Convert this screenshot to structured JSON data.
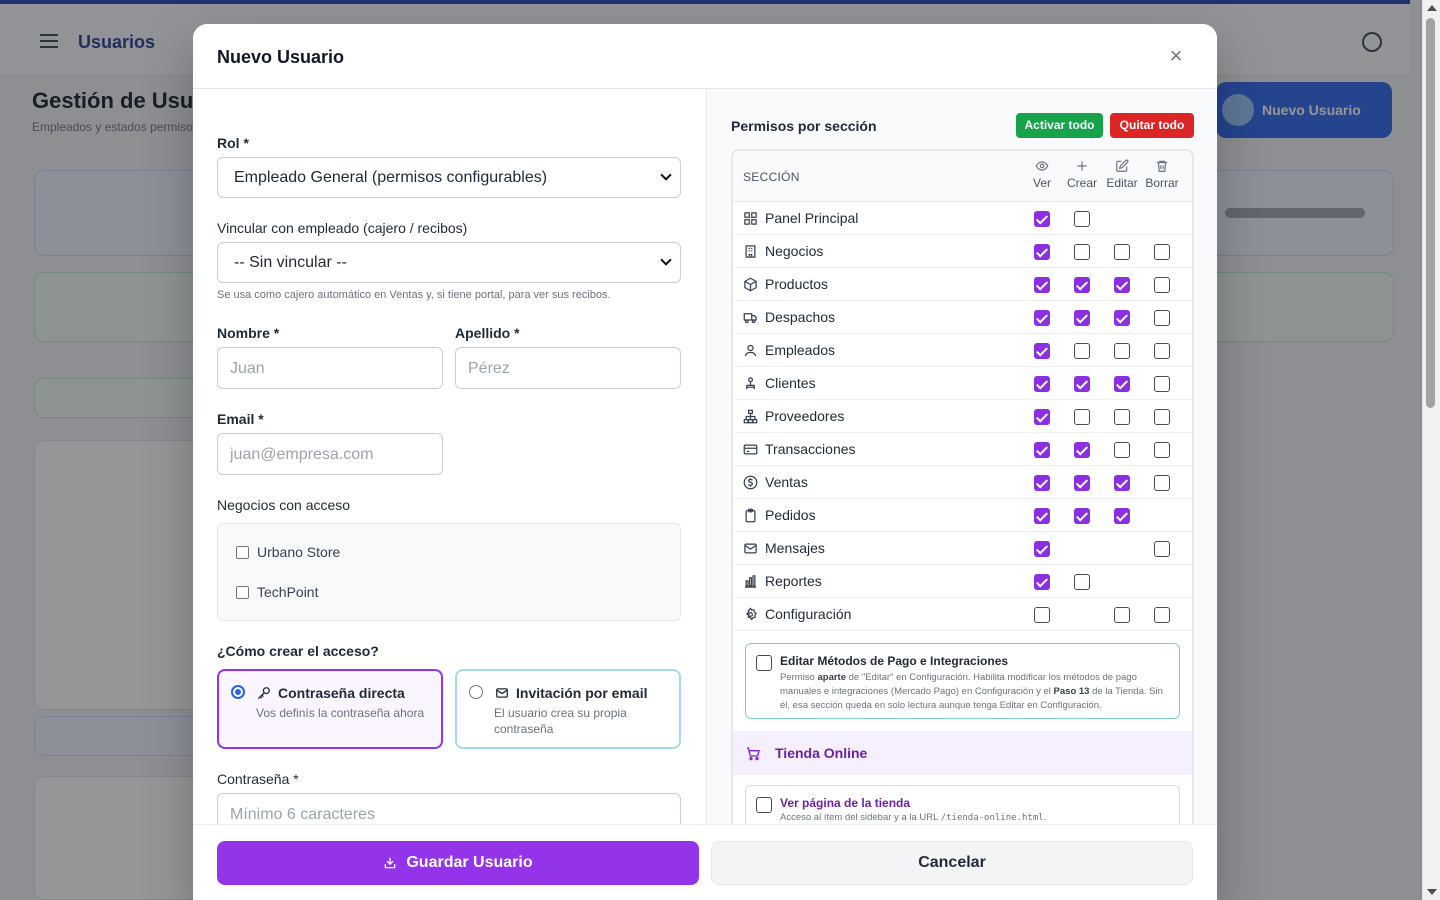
{
  "background": {
    "app_title": "Usuarios",
    "page_title": "Gestión de Usuarios",
    "page_subtitle": "Empleados y estados permisos",
    "primary_button": "Nuevo Usuario"
  },
  "modal": {
    "title": "Nuevo Usuario",
    "close_label": "×",
    "role": {
      "label": "Rol *",
      "value": "Empleado General (permisos configurables)"
    },
    "employee_link": {
      "label": "Vincular con empleado (cajero / recibos)",
      "value": "-- Sin vincular --",
      "help": "Se usa como cajero automático en Ventas y, si tiene portal, para ver sus recibos."
    },
    "first_name": {
      "label": "Nombre *",
      "placeholder": "Juan"
    },
    "last_name": {
      "label": "Apellido *",
      "placeholder": "Pérez"
    },
    "email": {
      "label": "Email *",
      "placeholder": "juan@empresa.com"
    },
    "businesses": {
      "label": "Negocios con acceso",
      "items": [
        {
          "label": "Urbano Store",
          "checked": false
        },
        {
          "label": "TechPoint",
          "checked": false
        }
      ]
    },
    "access": {
      "label": "¿Cómo crear el acceso?",
      "options": [
        {
          "title": "Contraseña directa",
          "desc": "Vos definís la contraseña ahora",
          "selected": true
        },
        {
          "title": "Invitación por email",
          "desc": "El usuario crea su propia contraseña",
          "selected": false
        }
      ]
    },
    "password": {
      "label": "Contraseña *",
      "placeholder": "Mínimo 6 caracteres"
    },
    "permissions": {
      "title": "Permisos por sección",
      "activate_all": "Activar todo",
      "remove_all": "Quitar todo",
      "section_header": "SECCIÓN",
      "columns": [
        "Ver",
        "Crear",
        "Editar",
        "Borrar"
      ],
      "rows": [
        {
          "label": "Panel Principal",
          "icon": "grid-icon",
          "values": [
            true,
            false,
            null,
            null
          ]
        },
        {
          "label": "Negocios",
          "icon": "building-icon",
          "values": [
            true,
            false,
            false,
            false
          ]
        },
        {
          "label": "Productos",
          "icon": "box-icon",
          "values": [
            true,
            true,
            true,
            false
          ]
        },
        {
          "label": "Despachos",
          "icon": "truck-icon",
          "values": [
            true,
            true,
            true,
            false
          ]
        },
        {
          "label": "Empleados",
          "icon": "user-icon",
          "values": [
            true,
            false,
            false,
            false
          ]
        },
        {
          "label": "Clientes",
          "icon": "users-icon",
          "values": [
            true,
            true,
            true,
            false
          ]
        },
        {
          "label": "Proveedores",
          "icon": "network-icon",
          "values": [
            true,
            false,
            false,
            false
          ]
        },
        {
          "label": "Transacciones",
          "icon": "card-icon",
          "values": [
            true,
            true,
            false,
            false
          ]
        },
        {
          "label": "Ventas",
          "icon": "dollar-icon",
          "values": [
            true,
            true,
            true,
            false
          ]
        },
        {
          "label": "Pedidos",
          "icon": "clipboard-icon",
          "values": [
            true,
            true,
            true,
            null
          ]
        },
        {
          "label": "Mensajes",
          "icon": "mail-icon",
          "values": [
            true,
            null,
            null,
            false
          ]
        },
        {
          "label": "Reportes",
          "icon": "chart-icon",
          "values": [
            true,
            false,
            null,
            null
          ]
        },
        {
          "label": "Configuración",
          "icon": "gear-icon",
          "values": [
            false,
            null,
            false,
            false
          ]
        }
      ]
    },
    "payment": {
      "title": "Editar Métodos de Pago e Integraciones",
      "desc_1": "Permiso ",
      "desc_bold_1": "aparte",
      "desc_2": " de \"Editar\" en Configuración. Habilita modificar los métodos de pago manuales e integraciones (Mercado Pago) en Configuración y el ",
      "desc_bold_2": "Paso 13",
      "desc_3": " de la Tienda. Sin él, esa sección queda en solo lectura aunque tenga Editar en Configuración."
    },
    "store": {
      "title": "Tienda Online",
      "view_title": "Ver página de la tienda",
      "view_desc": "Acceso al ítem del sidebar y a la URL ",
      "view_code": "/tienda-online.html",
      "view_desc_end": "."
    },
    "save_label": "Guardar Usuario",
    "cancel_label": "Cancelar"
  }
}
